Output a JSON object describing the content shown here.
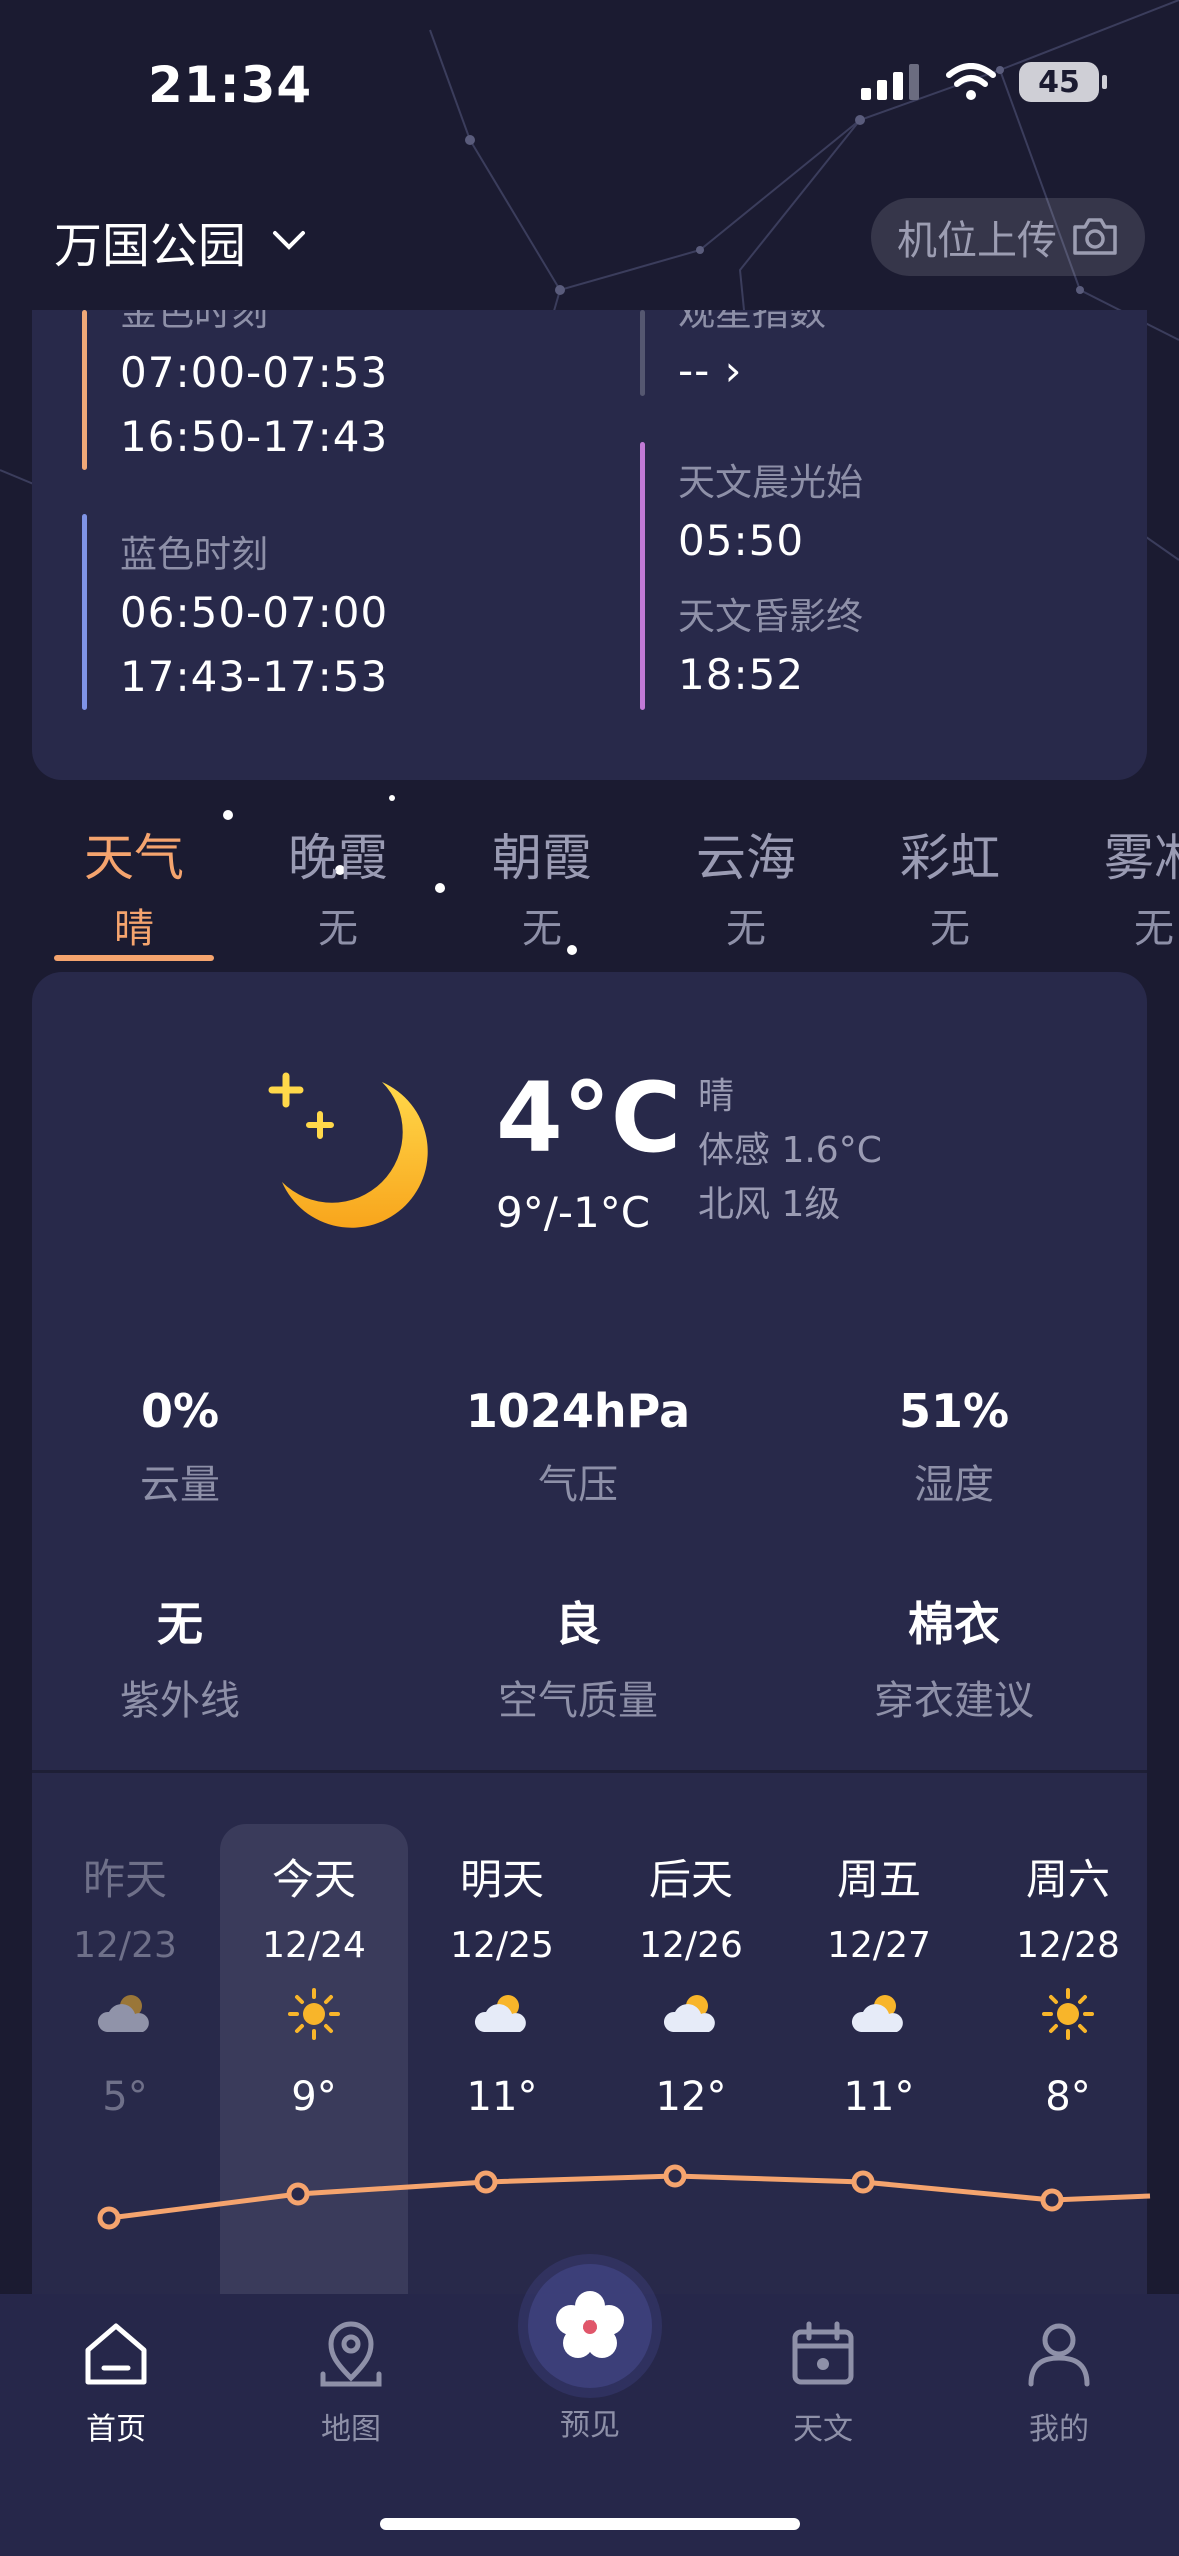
{
  "status_bar": {
    "time": "21:34",
    "battery": "45"
  },
  "header": {
    "location": "万国公园",
    "upload_label": "机位上传"
  },
  "twilight": {
    "golden_label": "金色时刻",
    "golden_morning": "07:00-07:53",
    "golden_evening": "16:50-17:43",
    "blue_label": "蓝色时刻",
    "blue_morning": "06:50-07:00",
    "blue_evening": "17:43-17:53",
    "viewing_label": "观星指数",
    "viewing_value": "-- ›",
    "astro_dawn_label": "天文晨光始",
    "astro_dawn_value": "05:50",
    "astro_dusk_label": "天文昏影终",
    "astro_dusk_value": "18:52"
  },
  "tabs": [
    {
      "label": "天气",
      "value": "晴"
    },
    {
      "label": "晚霞",
      "value": "无"
    },
    {
      "label": "朝霞",
      "value": "无"
    },
    {
      "label": "云海",
      "value": "无"
    },
    {
      "label": "彩虹",
      "value": "无"
    },
    {
      "label": "雾凇",
      "value": "无"
    }
  ],
  "weather": {
    "temperature": "4°C",
    "range": "9°/-1°C",
    "condition": "晴",
    "feels_like": "体感 1.6°C",
    "wind": "北风 1级",
    "icon": "moon-icon",
    "stats": [
      {
        "value": "0%",
        "label": "云量"
      },
      {
        "value": "1024hPa",
        "label": "气压"
      },
      {
        "value": "51%",
        "label": "湿度"
      },
      {
        "value": "无",
        "label": "紫外线"
      },
      {
        "value": "良",
        "label": "空气质量"
      },
      {
        "value": "棉衣",
        "label": "穿衣建议"
      }
    ]
  },
  "forecast": [
    {
      "name": "昨天",
      "date": "12/23",
      "icon": "cloud-sun-icon",
      "high": 5
    },
    {
      "name": "今天",
      "date": "12/24",
      "icon": "sun-icon",
      "high": 9
    },
    {
      "name": "明天",
      "date": "12/25",
      "icon": "cloud-sun-icon",
      "high": 11
    },
    {
      "name": "后天",
      "date": "12/26",
      "icon": "cloud-sun-icon",
      "high": 12
    },
    {
      "name": "周五",
      "date": "12/27",
      "icon": "cloud-sun-icon",
      "high": 11
    },
    {
      "name": "周六",
      "date": "12/28",
      "icon": "sun-icon",
      "high": 8
    }
  ],
  "forecast_labels": [
    "5°",
    "9°",
    "11°",
    "12°",
    "11°",
    "8°"
  ],
  "nav": [
    {
      "label": "首页",
      "icon": "home-icon"
    },
    {
      "label": "地图",
      "icon": "map-pin-icon"
    },
    {
      "label": "预见",
      "icon": "flower-icon"
    },
    {
      "label": "天文",
      "icon": "calendar-icon"
    },
    {
      "label": "我的",
      "icon": "user-icon"
    }
  ],
  "colors": {
    "accent": "#f5a46e",
    "card": "#28294a",
    "background": "#1b1b31",
    "blue_bar": "#7f93e6",
    "purple_bar": "#c17ad6"
  }
}
